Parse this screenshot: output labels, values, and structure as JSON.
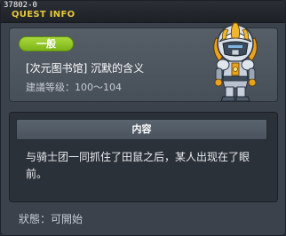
{
  "window": {
    "quest_id": "37802-0",
    "title": "QUEST INFO"
  },
  "header": {
    "category_tag": "一般",
    "quest_name": "[次元图书馆] 沉默的含义",
    "level_label": "建議等级：",
    "level_range": "100～104",
    "npc_icon": "armored-knight-npc-icon"
  },
  "content": {
    "header_label": "内容",
    "description": "与骑士团一同抓住了田鼠之后，某人出现在了眼前。"
  },
  "footer": {
    "status_label": "狀態：",
    "status_value": "可開始"
  },
  "colors": {
    "title_yellow": "#e8c83a",
    "tag_green": "#8cc424",
    "window_bg": "#3b424c",
    "panel_dark": "#2b3139"
  }
}
